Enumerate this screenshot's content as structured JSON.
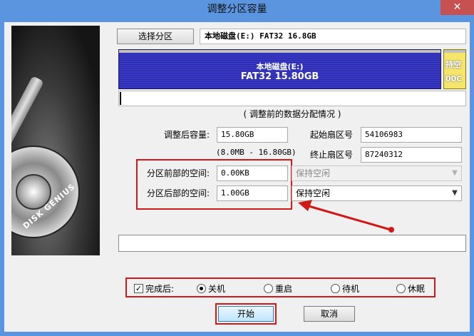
{
  "window": {
    "title": "调整分区容量",
    "close_glyph": "✕"
  },
  "sidebar": {
    "brand": "DISK GENIUS"
  },
  "toolbar": {
    "select_partition_label": "选择分区",
    "partition_info": "本地磁盘(E:) FAT32 16.8GB"
  },
  "disk_map": {
    "main_name": "本地磁盘(E:)",
    "main_detail": "FAT32 15.80GB",
    "free_name": "持空",
    "free_detail": "00C"
  },
  "section": {
    "title": "( 调整前的数据分配情况 )"
  },
  "form": {
    "size_after_label": "调整后容量:",
    "size_after_value": "15.80GB",
    "size_range": "(8.0MB - 16.80GB)",
    "start_sector_label": "起始扇区号",
    "start_sector_value": "54106983",
    "end_sector_label": "终止扇区号",
    "end_sector_value": "87240312",
    "before_space_label": "分区前部的空间:",
    "before_space_value": "0.00KB",
    "before_space_mode": "保持空闲",
    "after_space_label": "分区后部的空间:",
    "after_space_value": "1.00GB",
    "after_space_mode": "保持空闲"
  },
  "completion": {
    "checkbox_label": "完成后:",
    "checked": true,
    "options": [
      "关机",
      "重启",
      "待机",
      "休眠"
    ],
    "selected": "关机"
  },
  "buttons": {
    "start": "开始",
    "cancel": "取消"
  },
  "colors": {
    "highlight": "#d01818",
    "partition_fill": "#3838c4",
    "free_fill": "#f5e56a",
    "titlebar": "#5b95e0"
  }
}
